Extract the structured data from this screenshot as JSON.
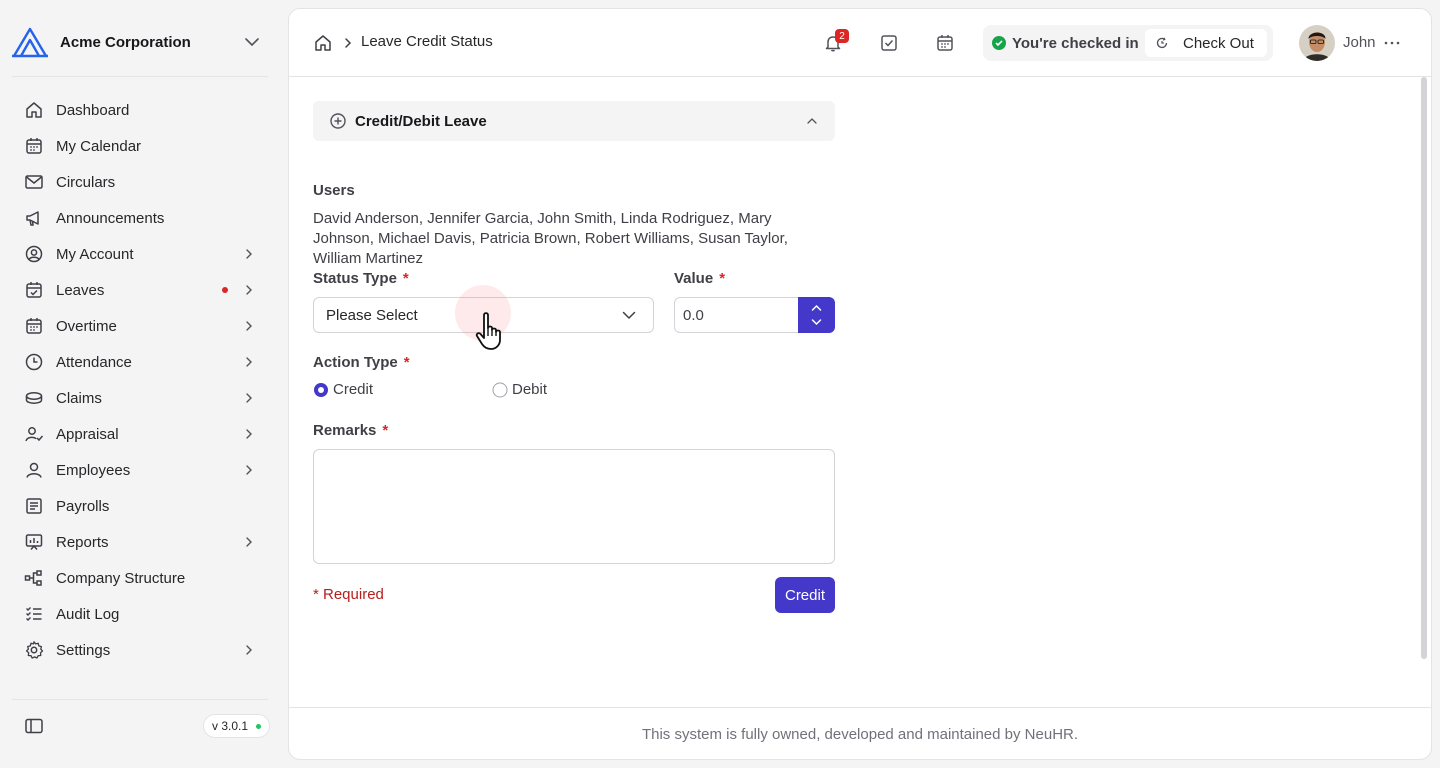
{
  "sidebar": {
    "org_name": "Acme Corporation",
    "items": [
      {
        "label": "Dashboard"
      },
      {
        "label": "My Calendar"
      },
      {
        "label": "Circulars"
      },
      {
        "label": "Announcements"
      },
      {
        "label": "My Account"
      },
      {
        "label": "Leaves"
      },
      {
        "label": "Overtime"
      },
      {
        "label": "Attendance"
      },
      {
        "label": "Claims"
      },
      {
        "label": "Appraisal"
      },
      {
        "label": "Employees"
      },
      {
        "label": "Payrolls"
      },
      {
        "label": "Reports"
      },
      {
        "label": "Company Structure"
      },
      {
        "label": "Audit Log"
      },
      {
        "label": "Settings"
      }
    ],
    "version": "v 3.0.1"
  },
  "header": {
    "breadcrumb_title": "Leave Credit Status",
    "notification_count": "2",
    "checkin_status": "You're checked in",
    "checkout_label": "Check Out",
    "user_name": "John"
  },
  "form": {
    "section_title": "Credit/Debit Leave",
    "users_label": "Users",
    "users_value": "David Anderson, Jennifer Garcia, John Smith, Linda Rodriguez, Mary Johnson, Michael Davis, Patricia Brown, Robert Williams, Susan Taylor, William Martinez",
    "status_type_label": "Status Type",
    "status_type_value": "Please Select",
    "value_label": "Value",
    "value_value": "0.0",
    "action_type_label": "Action Type",
    "action_options": [
      "Credit",
      "Debit"
    ],
    "action_selected": "Credit",
    "remarks_label": "Remarks",
    "required_asterisk": "*",
    "required_note": "* Required",
    "submit_label": "Credit"
  },
  "footer": {
    "text": "This system is fully owned, developed and maintained by NeuHR."
  },
  "colors": {
    "accent": "#4338ca",
    "required": "#dc2626",
    "success": "#16a34a"
  }
}
